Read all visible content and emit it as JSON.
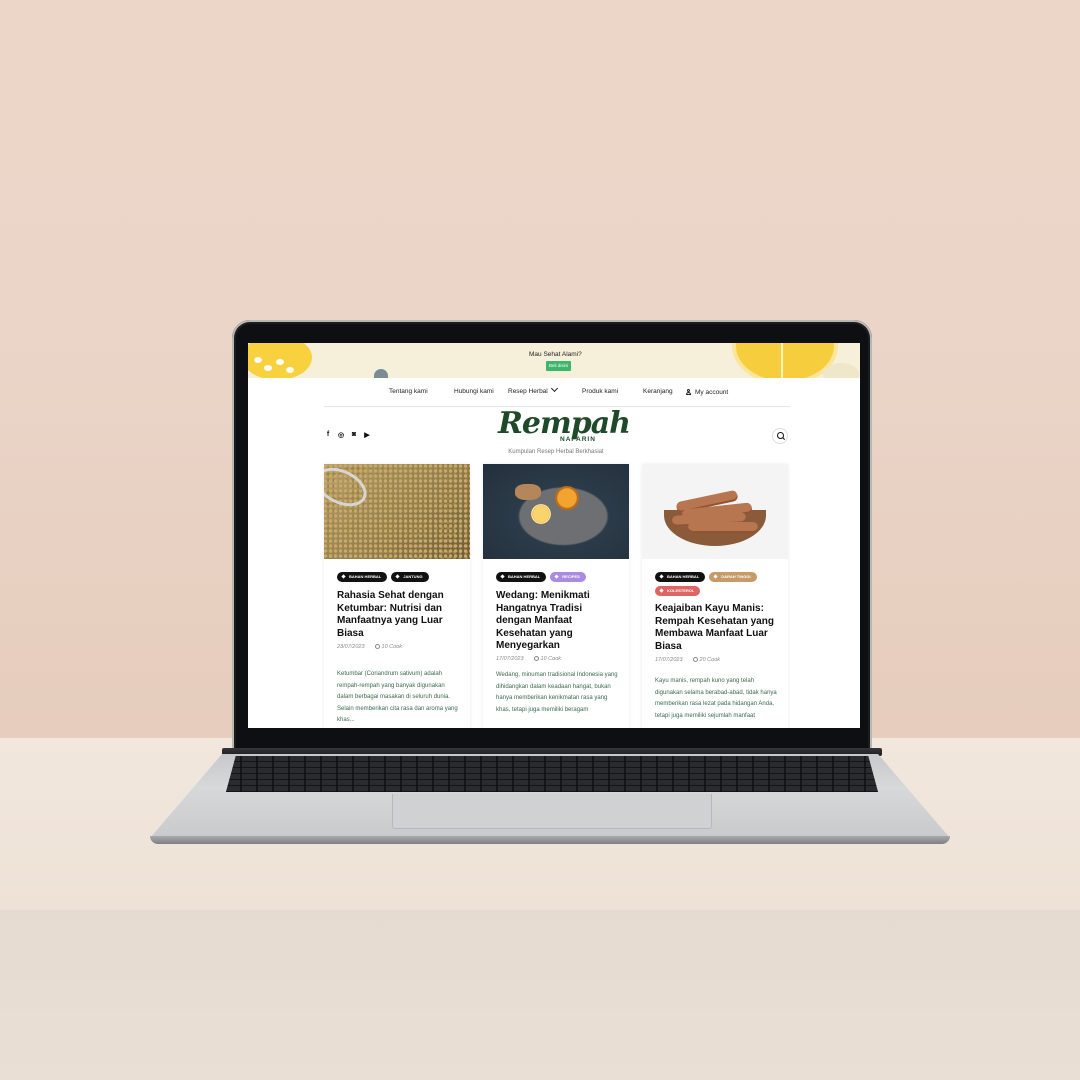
{
  "banner": {
    "text": "Mau Sehat Alami?",
    "button": "Beli disini"
  },
  "nav": {
    "about": "Tentang kami",
    "contact": "Hubungi kami",
    "recipes": "Resep Herbal",
    "products": "Produk kami",
    "cart": "Keranjang",
    "account": "My account"
  },
  "social": {
    "facebook": "f",
    "whatsapp": "◎",
    "instagram": "◙",
    "youtube": "▶"
  },
  "logo": {
    "script": "Rempah",
    "sub": "NAFARIN",
    "tagline": "Kumpulan Resep Herbal Berkhasiat"
  },
  "colors": {
    "tag_black": "#111111",
    "tag_purple": "#a98be0",
    "tag_tan": "#c79a67",
    "tag_red": "#e06464",
    "accent_green": "#3db56d",
    "logo_green": "#1f4a2a"
  },
  "posts": [
    {
      "tags": [
        "BAHAN HERBAL",
        "JANTUNG"
      ],
      "title": "Rahasia Sehat dengan Ketumbar: Nutrisi dan Manfaatnya yang Luar Biasa",
      "date": "23/07/2023",
      "cook": "10 Cook",
      "excerpt": "Ketumbar (Coriandrum sativum) adalah rempah-rempah yang banyak digunakan dalam berbagai masakan di seluruh dunia. Selain memberikan cita rasa dan aroma yang khas..."
    },
    {
      "tags": [
        "BAHAN HERBAL",
        "RECIPES"
      ],
      "title": "Wedang: Menikmati Hangatnya Tradisi dengan Manfaat Kesehatan yang Menyegarkan",
      "date": "17/07/2023",
      "cook": "10 Cook",
      "excerpt": "Wedang, minuman tradisional Indonesia yang dihidangkan dalam keadaan hangat, bukan hanya memberikan kenikmatan rasa yang khas, tetapi juga memiliki beragam"
    },
    {
      "tags": [
        "BAHAN HERBAL",
        "DARAH TINGGI",
        "KOLESTEROL"
      ],
      "title": "Keajaiban Kayu Manis: Rempah Kesehatan yang Membawa Manfaat Luar Biasa",
      "date": "17/07/2023",
      "cook": "20 Cook",
      "excerpt": "Kayu manis, rempah kuno yang telah digunakan selama berabad-abad, tidak hanya memberikan rasa lezat pada hidangan Anda, tetapi juga memiliki sejumlah manfaat"
    }
  ]
}
